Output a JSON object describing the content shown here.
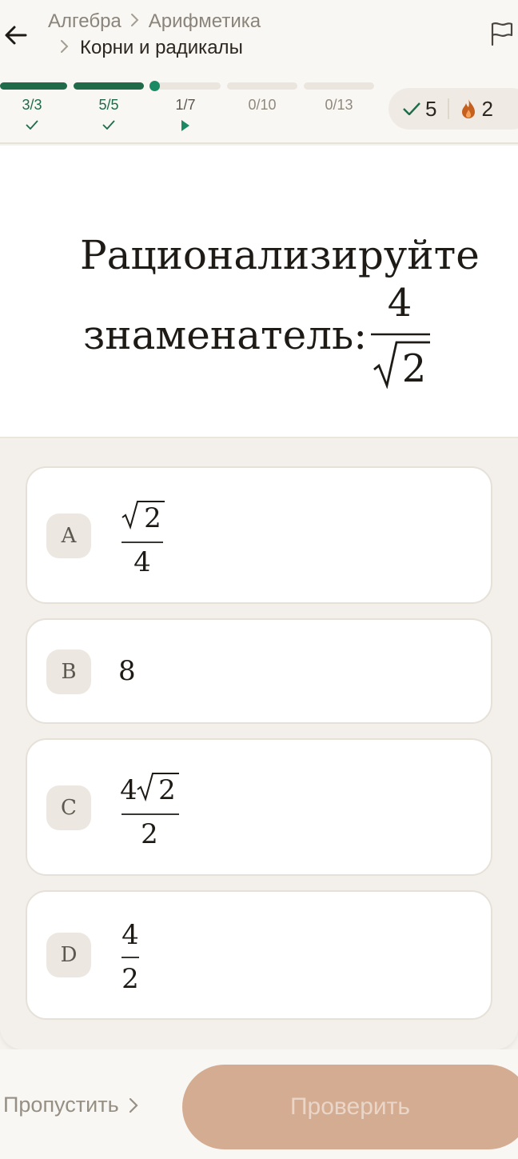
{
  "breadcrumb": {
    "subject": "Алгебра",
    "topic": "Арифметика",
    "subtopic": "Корни и радикалы"
  },
  "progress": {
    "segments": [
      {
        "label": "3/3",
        "state": "done"
      },
      {
        "label": "5/5",
        "state": "done"
      },
      {
        "label": "1/7",
        "state": "current"
      },
      {
        "label": "0/10",
        "state": "pending"
      },
      {
        "label": "0/13",
        "state": "pending"
      }
    ]
  },
  "stats": {
    "correct": "5",
    "streak": "2"
  },
  "question": {
    "line1": "Рационализируйте",
    "line2": "знаменатель:",
    "numerator": "4",
    "denominator_radicand": "2"
  },
  "options": [
    {
      "letter": "A",
      "numerator_radicand": "2",
      "denominator": "4"
    },
    {
      "letter": "B",
      "value": "8"
    },
    {
      "letter": "C",
      "numerator_coef": "4",
      "numerator_radicand": "2",
      "denominator": "2"
    },
    {
      "letter": "D",
      "numerator": "4",
      "denominator": "2"
    }
  ],
  "footer": {
    "skip_label": "Пропустить",
    "check_label": "Проверить"
  },
  "colors": {
    "accent_green": "#1f6b4a",
    "check_button": "#d4ac92",
    "streak_flame": "#c5601f"
  },
  "icons": [
    "back-arrow-icon",
    "chevron-right-icon",
    "flag-icon",
    "checkmark-icon",
    "play-triangle-icon",
    "flame-icon"
  ]
}
